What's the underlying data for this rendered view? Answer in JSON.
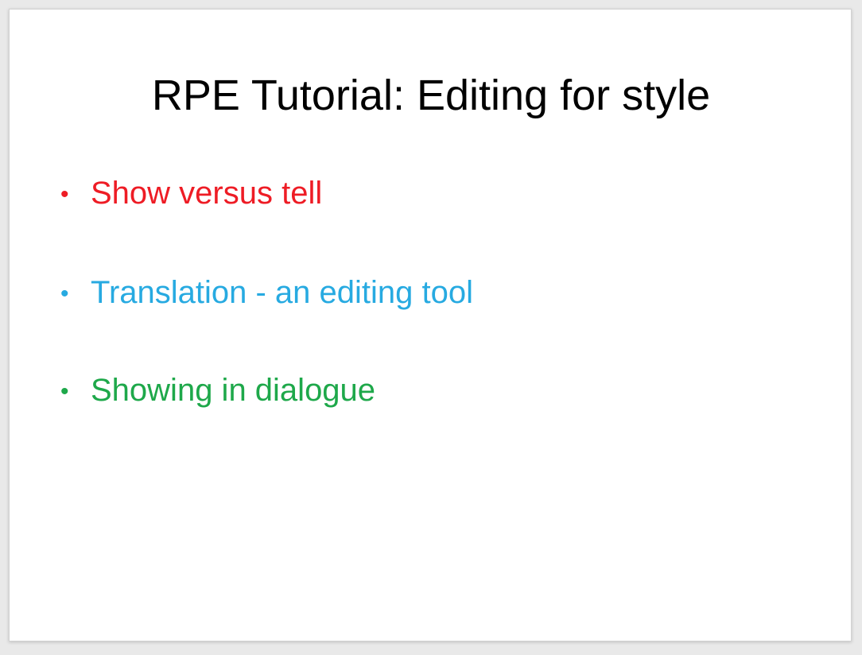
{
  "slide": {
    "title": "RPE Tutorial: Editing for style",
    "bullets": [
      {
        "marker": "•",
        "text": "Show versus tell",
        "color": "#ee1c25"
      },
      {
        "marker": "•",
        "text": "Translation - an editing tool",
        "color": "#27aae1"
      },
      {
        "marker": "•",
        "text": "Showing in dialogue",
        "color": "#1ea84a"
      }
    ]
  }
}
